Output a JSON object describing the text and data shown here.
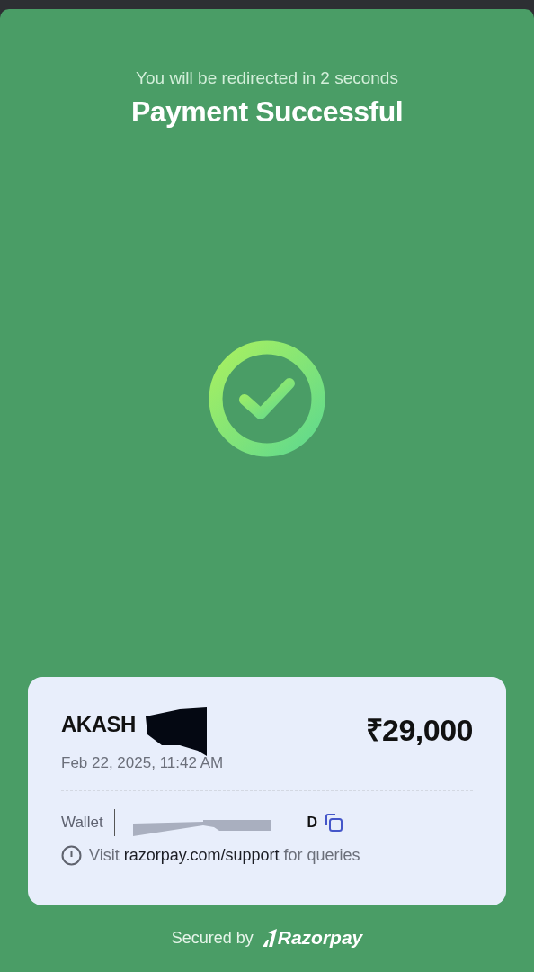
{
  "redirect_text": "You will be redirected in 2 seconds",
  "title": "Payment Successful",
  "receipt": {
    "name": "AKASH",
    "amount": "₹29,000",
    "date": "Feb 22, 2025, 11:42 AM",
    "method": "Wallet",
    "account_tail": "D",
    "support": {
      "prefix": "Visit ",
      "link": "razorpay.com/support",
      "suffix": " for queries"
    }
  },
  "footer": {
    "label": "Secured by",
    "brand": "Razorpay"
  }
}
